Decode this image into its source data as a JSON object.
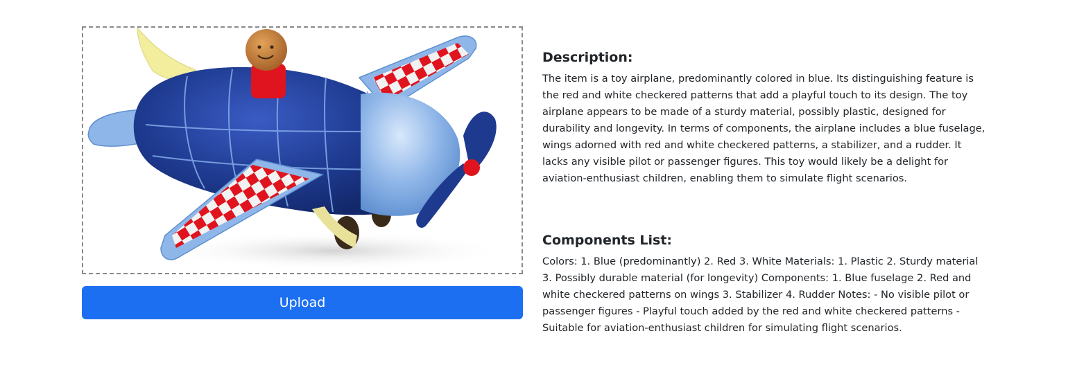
{
  "image": {
    "alt": "Toy airplane"
  },
  "upload": {
    "label": "Upload"
  },
  "description": {
    "title": "Description:",
    "text": "The item is a toy airplane, predominantly colored in blue. Its distinguishing feature is the red and white checkered patterns that add a playful touch to its design. The toy airplane appears to be made of a sturdy material, possibly plastic, designed for durability and longevity. In terms of components, the airplane includes a blue fuselage, wings adorned with red and white checkered patterns, a stabilizer, and a rudder. It lacks any visible pilot or passenger figures. This toy would likely be a delight for aviation-enthusiast children, enabling them to simulate flight scenarios."
  },
  "components": {
    "title": "Components List:",
    "text": "Colors: 1. Blue (predominantly) 2. Red 3. White Materials: 1. Plastic 2. Sturdy material 3. Possibly durable material (for longevity) Components: 1. Blue fuselage 2. Red and white checkered patterns on wings 3. Stabilizer 4. Rudder Notes: - No visible pilot or passenger figures - Playful touch added by the red and white checkered patterns - Suitable for aviation-enthusiast children for simulating flight scenarios."
  },
  "colors": {
    "upload_button": "#1d6ff2",
    "fuselage": "#1e3a8f",
    "wing": "#8fb6e8",
    "checker_red": "#e0141e",
    "checker_white": "#f2f2f2"
  }
}
